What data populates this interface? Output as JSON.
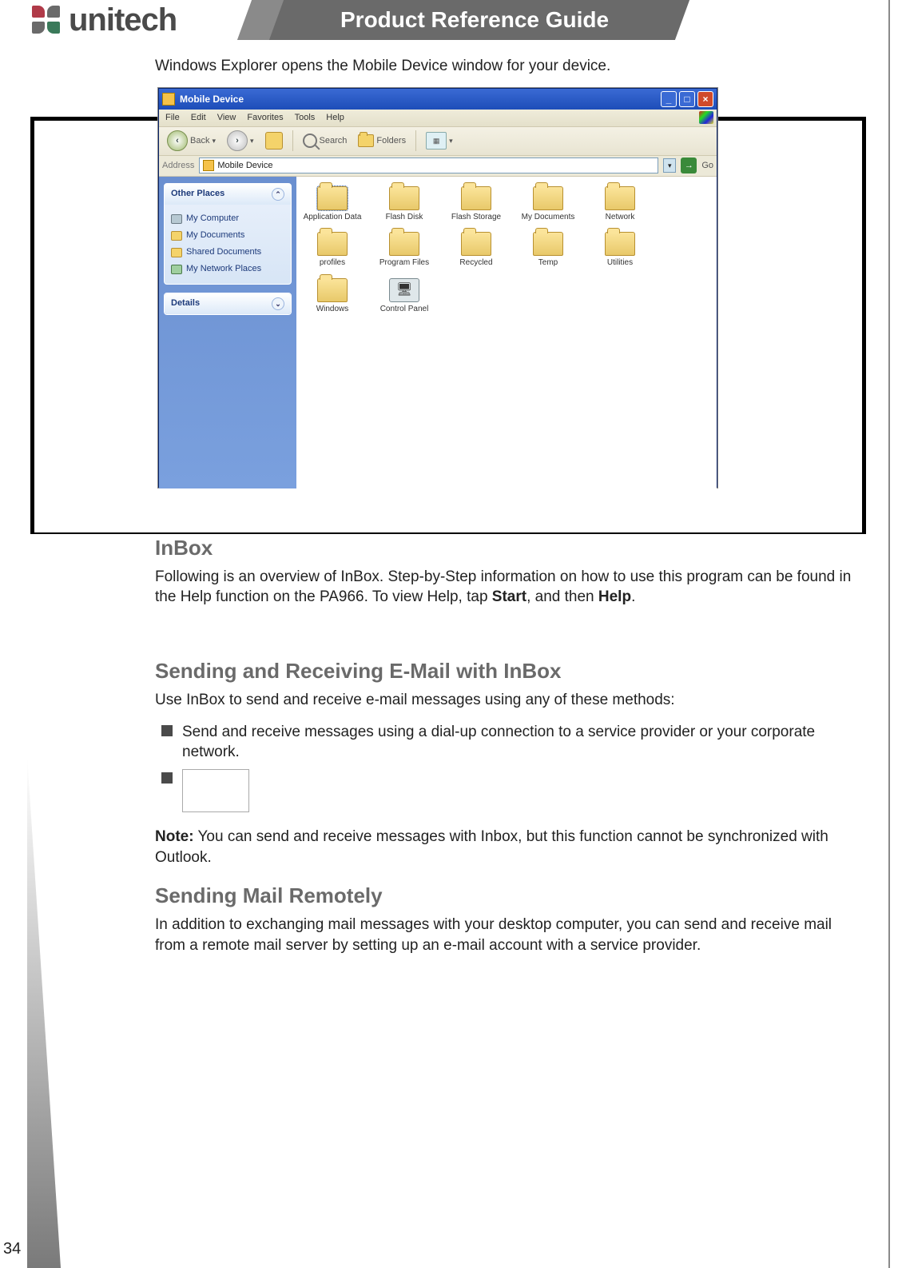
{
  "header": {
    "brand": "unitech",
    "title": "Product Reference Guide"
  },
  "intro": "Windows Explorer opens the Mobile Device window for your device.",
  "explorer": {
    "window_title": "Mobile Device",
    "menu": [
      "File",
      "Edit",
      "View",
      "Favorites",
      "Tools",
      "Help"
    ],
    "toolbar": {
      "back": "Back",
      "search": "Search",
      "folders": "Folders"
    },
    "address_label": "Address",
    "address_value": "Mobile Device",
    "go": "Go",
    "sidepane": {
      "other_places_title": "Other Places",
      "other_places": [
        "My Computer",
        "My Documents",
        "Shared Documents",
        "My Network Places"
      ],
      "details_title": "Details"
    },
    "folders_row1": [
      "Application Data",
      "Flash Disk",
      "Flash Storage",
      "My Documents",
      "Network",
      "profiles",
      "Program Files"
    ],
    "folders_row2": [
      "Recycled",
      "Temp",
      "Utilities",
      "Windows",
      "Control Panel"
    ]
  },
  "sections": {
    "inbox_title": "InBox",
    "inbox_body_a": "Following is an overview of InBox.  Step-by-Step information on how to use this program can be found in the Help function on the PA966.  To view Help, tap ",
    "inbox_body_start": "Start",
    "inbox_body_mid": ", and then ",
    "inbox_body_help": "Help",
    "inbox_body_end": ".",
    "sendrecv_title": "Sending and Receiving E-Mail with InBox",
    "sendrecv_intro": "Use InBox to send and receive e-mail messages using any of these methods:",
    "bullet1": "Send and receive messages using a dial-up connection to a service provider or your corporate network.",
    "note_label": "Note:",
    "note_body": "  You can send and receive messages with Inbox, but this function cannot be synchronized with Outlook.",
    "remote_title": "Sending Mail Remotely",
    "remote_body": "In addition to exchanging mail messages with your desktop computer, you can send and receive mail from a remote mail server by setting up an e-mail account with a service provider."
  },
  "page_number": "34"
}
